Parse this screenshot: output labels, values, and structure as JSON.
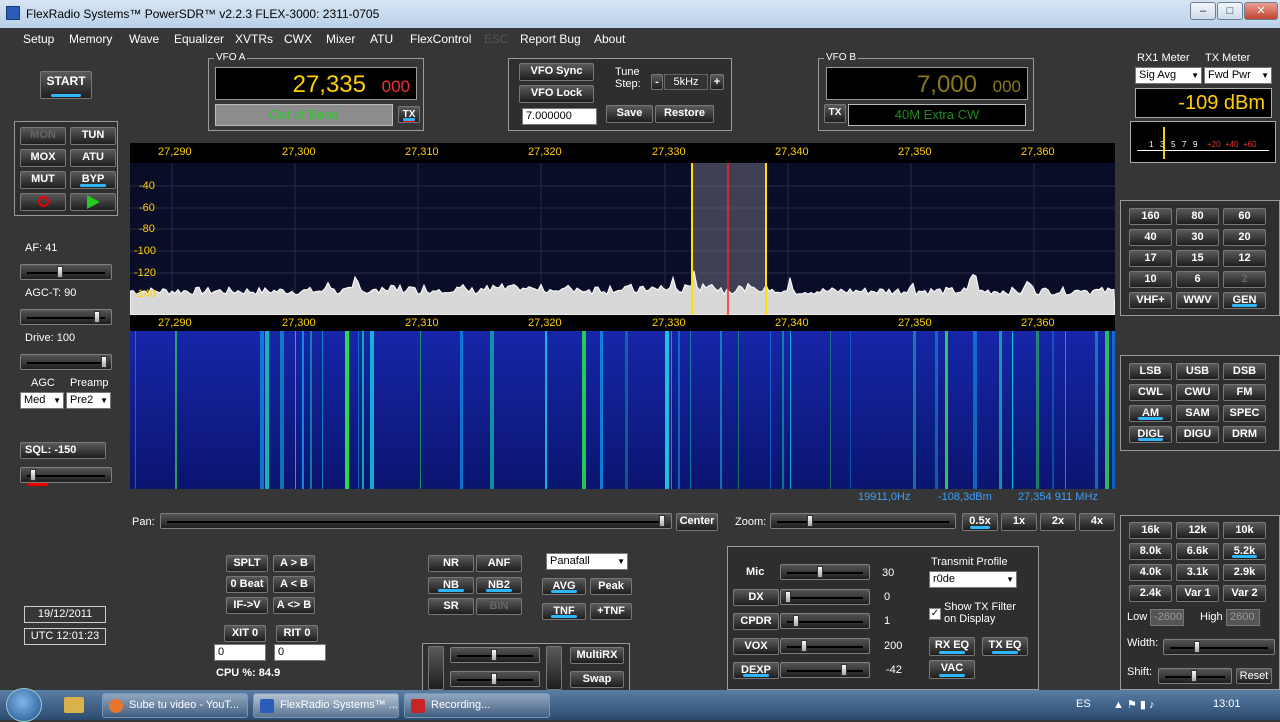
{
  "window": {
    "title": "FlexRadio Systems™  PowerSDR™  v2.2.3   FLEX-3000: 2311-0705",
    "min": "–",
    "max": "□",
    "close": "✕"
  },
  "menu": [
    "Setup",
    "Memory",
    "Wave",
    "Equalizer",
    "XVTRs",
    "CWX",
    "Mixer",
    "ATU",
    "FlexControl",
    "ESC",
    "Report Bug",
    "About"
  ],
  "left": {
    "start": "START",
    "row1": [
      "MON",
      "TUN"
    ],
    "row2": [
      "MOX",
      "ATU"
    ],
    "row3": [
      "MUT",
      "BYP"
    ],
    "af": "AF:  41",
    "agct": "AGC-T:  90",
    "drive": "Drive:  100",
    "agc": "AGC",
    "preamp": "Preamp",
    "agc_val": "Med",
    "preamp_val": "Pre2",
    "sql": "SQL: -150",
    "date": "19/12/2011",
    "utc": "UTC 12:01:23",
    "af_level": 0.41,
    "agct_level": 0.9,
    "drive_level": 1.0
  },
  "vfoa": {
    "label": "VFO A",
    "freq": "27,335",
    "freq_small": "000",
    "status": "Out of Band",
    "tx": "TX"
  },
  "vfomid": {
    "sync": "VFO Sync",
    "lock": "VFO Lock",
    "tune_step_label1": "Tune",
    "tune_step_label2": "Step:",
    "tune_step": "5kHz",
    "minus": "-",
    "plus": "+",
    "value": "7.000000",
    "save": "Save",
    "restore": "Restore"
  },
  "vfob": {
    "label": "VFO B",
    "freq": "7,000",
    "freq_small": "000",
    "tx": "TX",
    "status": "40M Extra CW"
  },
  "meter": {
    "rx_label": "RX1 Meter",
    "tx_label": "TX Meter",
    "rx_sel": "Sig Avg",
    "tx_sel": "Fwd Pwr",
    "value": "-109 dBm",
    "scale": [
      "1",
      "3",
      "5",
      "7",
      "9",
      "+20",
      "+40",
      "+60"
    ]
  },
  "spectrum": {
    "freqs": [
      "27,290",
      "27,300",
      "27,310",
      "27,320",
      "27,330",
      "27,340",
      "27,350",
      "27,360"
    ],
    "db": [
      "-40",
      "-60",
      "-80",
      "-100",
      "-120",
      "-140"
    ],
    "status": [
      "19911,0Hz",
      "-108,3dBm",
      "27,354 911 MHz"
    ]
  },
  "bands": [
    "160",
    "80",
    "60",
    "40",
    "30",
    "20",
    "17",
    "15",
    "12",
    "10",
    "6",
    "2",
    "VHF+",
    "WWV",
    "GEN"
  ],
  "modes": [
    "LSB",
    "USB",
    "DSB",
    "CWL",
    "CWU",
    "FM",
    "AM",
    "SAM",
    "SPEC",
    "DIGL",
    "DIGU",
    "DRM"
  ],
  "filters": [
    "16k",
    "12k",
    "10k",
    "8.0k",
    "6.6k",
    "5.2k",
    "4.0k",
    "3.1k",
    "2.9k",
    "2.4k",
    "Var 1",
    "Var 2"
  ],
  "filter_ctrl": {
    "low": "Low",
    "low_val": "-2600",
    "high": "High",
    "high_val": "2600",
    "width": "Width:",
    "shift": "Shift:",
    "reset": "Reset"
  },
  "pan": {
    "pan": "Pan:",
    "center": "Center",
    "zoom": "Zoom:",
    "zooms": [
      "0.5x",
      "1x",
      "2x",
      "4x"
    ]
  },
  "bottom": {
    "splt": "SPLT",
    "a2b": "A > B",
    "zbeat": "0 Beat",
    "b2a": "A < B",
    "ifv": "IF->V",
    "swap": "A <> B",
    "xit": "XIT",
    "xit_n": "0",
    "rit": "RIT",
    "rit_n": "0",
    "xit_val": "0",
    "rit_val": "0",
    "cpu": "CPU %:  84.9"
  },
  "dsp": {
    "nr": "NR",
    "anf": "ANF",
    "nb": "NB",
    "nb2": "NB2",
    "sr": "SR",
    "bin": "BIN",
    "display": "Panafall",
    "avg": "AVG",
    "peak": "Peak",
    "tnf": "TNF",
    "ptnf": "+TNF",
    "multirx": "MultiRX",
    "swap": "Swap"
  },
  "tx": {
    "mic": "Mic",
    "mic_v": "30",
    "dx": "DX",
    "dx_v": "0",
    "cpdr": "CPDR",
    "cpdr_v": "1",
    "vox": "VOX",
    "vox_v": "200",
    "dexp": "DEXP",
    "dexp_v": "-42",
    "profile_label": "Transmit Profile",
    "profile": "r0de",
    "show_filter": "Show TX Filter on Display",
    "rxeq": "RX EQ",
    "txeq": "TX EQ",
    "vac": "VAC"
  },
  "taskbar": {
    "t1": "Sube tu video - YouT...",
    "t2": "FlexRadio Systems™ ...",
    "t3": "Recording...",
    "lang": "ES",
    "time": "13:01"
  },
  "colors": {
    "accent": "#2fb6ff",
    "vfo_yellow": "#ffd000",
    "red": "#ff2a2a",
    "green": "#22cc22"
  }
}
